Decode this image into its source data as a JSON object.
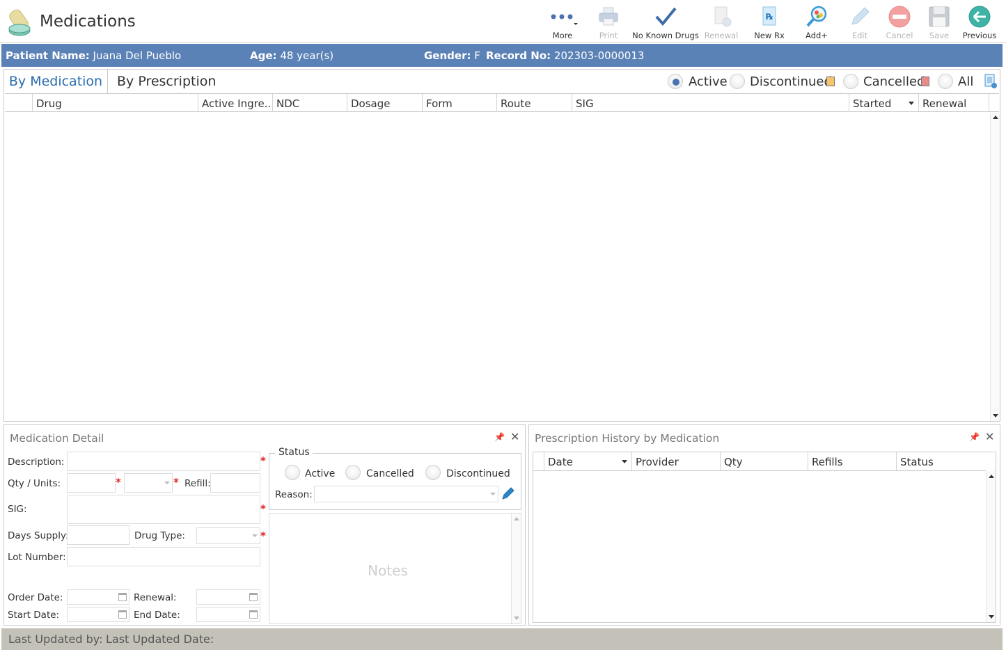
{
  "app": {
    "title": "Medications",
    "icons": {
      "logo": "pill-bottle-icon"
    }
  },
  "toolbar": [
    {
      "id": "more",
      "label": "More",
      "icon": "more-dots-icon",
      "enabled": true
    },
    {
      "id": "print",
      "label": "Print",
      "icon": "printer-icon",
      "enabled": false
    },
    {
      "id": "no-known-drugs",
      "label": "No Known Drugs",
      "icon": "checkmark-icon",
      "enabled": true
    },
    {
      "id": "renewal",
      "label": "Renewal",
      "icon": "document-renew-icon",
      "enabled": false
    },
    {
      "id": "new-rx",
      "label": "New Rx",
      "icon": "prescription-icon",
      "enabled": true
    },
    {
      "id": "add-plus",
      "label": "Add+",
      "icon": "magnifier-pills-icon",
      "enabled": true
    },
    {
      "id": "edit",
      "label": "Edit",
      "icon": "pencil-icon",
      "enabled": false
    },
    {
      "id": "cancel",
      "label": "Cancel",
      "icon": "no-entry-icon",
      "enabled": false
    },
    {
      "id": "save",
      "label": "Save",
      "icon": "floppy-disk-icon",
      "enabled": false
    },
    {
      "id": "previous",
      "label": "Previous",
      "icon": "back-arrow-icon",
      "enabled": true
    }
  ],
  "patient": {
    "name_label": "Patient Name:",
    "name": "Juana Del Pueblo",
    "age_label": "Age:",
    "age": "48 year(s)",
    "gender_label": "Gender:",
    "gender": "F",
    "record_label": "Record No:",
    "record": "202303-0000013"
  },
  "tabs": {
    "by_medication": "By Medication",
    "by_prescription": "By Prescription",
    "active_tab": "By Medication"
  },
  "filters": {
    "options": [
      "Active",
      "Discontinued",
      "Cancelled",
      "All"
    ],
    "selected": "Active",
    "discontinued_color": "#f7c46c",
    "cancelled_color": "#e98a8a"
  },
  "med_grid": {
    "columns": [
      "Drug",
      "Active Ingre...",
      "NDC",
      "Dosage",
      "Form",
      "Route",
      "SIG",
      "Started",
      "Renewal"
    ],
    "rows": []
  },
  "detail": {
    "title": "Medication Detail",
    "labels": {
      "description": "Description:",
      "qty_units": "Qty / Units:",
      "refill": "Refill:",
      "sig": "SIG:",
      "days_supply": "Days Supply:",
      "drug_type": "Drug Type:",
      "lot_number": "Lot Number:",
      "order_date": "Order Date:",
      "renewal": "Renewal:",
      "start_date": "Start Date:",
      "end_date": "End Date:"
    },
    "status": {
      "legend": "Status",
      "options": [
        "Active",
        "Cancelled",
        "Discontinued"
      ],
      "reason_label": "Reason:"
    },
    "notes_placeholder": "Notes"
  },
  "history": {
    "title": "Prescription History by Medication",
    "columns": [
      "Date",
      "Provider",
      "Qty",
      "Refills",
      "Status"
    ],
    "rows": []
  },
  "footer": {
    "last_updated_by": "Last Updated by:",
    "last_updated_date": "Last Updated Date:"
  },
  "colors": {
    "patient_bar": "#5b82b6",
    "accent_tab": "#2b6cb0",
    "footer": "#c4c2b8"
  }
}
